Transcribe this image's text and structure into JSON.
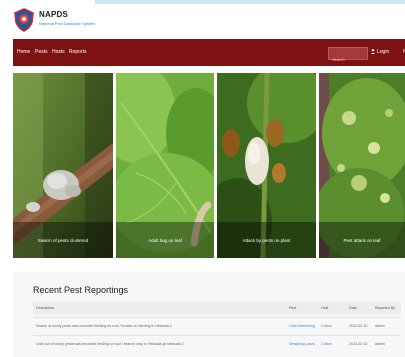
{
  "header": {
    "brand_name": "NAPDS",
    "brand_subtitle": "National Pest Database System"
  },
  "nav": {
    "items": [
      "Home",
      "Pests",
      "Hosts",
      "Reports"
    ],
    "search_placeholder": "Search",
    "login_label": "Login",
    "extra_label": "N"
  },
  "gallery": {
    "cards": [
      {
        "caption": "Swarm of pests clustered"
      },
      {
        "caption": "Adult bug on leaf"
      },
      {
        "caption": "Attack by pests on plant"
      },
      {
        "caption": "Pest attack on leaf"
      }
    ]
  },
  "reports": {
    "title": "Recent Pest Reportings",
    "columns": [
      "Description",
      "Pest",
      "Host",
      "Date",
      "Reported By"
    ],
    "rows": [
      {
        "description": "Swarm of wooly pests was recorded feeding on root / branch on farming in Hetauda 1",
        "pest": "Cloth Monitoring",
        "host": "Cotton",
        "date": "2022-02-10",
        "reported_by": "admin"
      },
      {
        "description": "Leaf curl of wooly pests was recorded feeding on root / branch crop in Hetauda gh hetauda 3",
        "pest": "Mealybug Larva",
        "host": "Cotton",
        "date": "2022-02-10",
        "reported_by": "admin"
      }
    ]
  },
  "colors": {
    "navbar": "#7e1212",
    "link": "#3a86c8"
  },
  "icons": [
    "napds-logo",
    "user-icon"
  ]
}
